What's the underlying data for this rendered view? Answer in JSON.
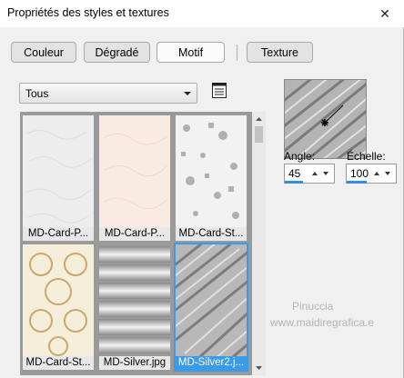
{
  "window": {
    "title": "Propriétés des styles et textures",
    "close_glyph": "✕"
  },
  "tabs": [
    {
      "label": "Couleur",
      "active": false
    },
    {
      "label": "Dégradé",
      "active": false
    },
    {
      "label": "Motif",
      "active": true
    },
    {
      "label": "Texture",
      "active": false
    }
  ],
  "category": {
    "selected": "Tous"
  },
  "thumbnails": [
    {
      "label": "MD-Card-P...",
      "selected": false
    },
    {
      "label": "MD-Card-P...",
      "selected": false
    },
    {
      "label": "MD-Card-St...",
      "selected": false
    },
    {
      "label": "MD-Card-St...",
      "selected": false
    },
    {
      "label": "MD-Silver.jpg",
      "selected": false
    },
    {
      "label": "MD-Silver2.j...",
      "selected": true
    }
  ],
  "angle": {
    "label": "Angle:",
    "value": "45"
  },
  "scale": {
    "label": "Échelle:",
    "value": "100"
  },
  "watermark": {
    "line1": "Pinuccia",
    "line2": "www.maidiregrafica.e"
  },
  "colors": {
    "accent": "#3b9be6",
    "background": "#f0f0f0"
  }
}
